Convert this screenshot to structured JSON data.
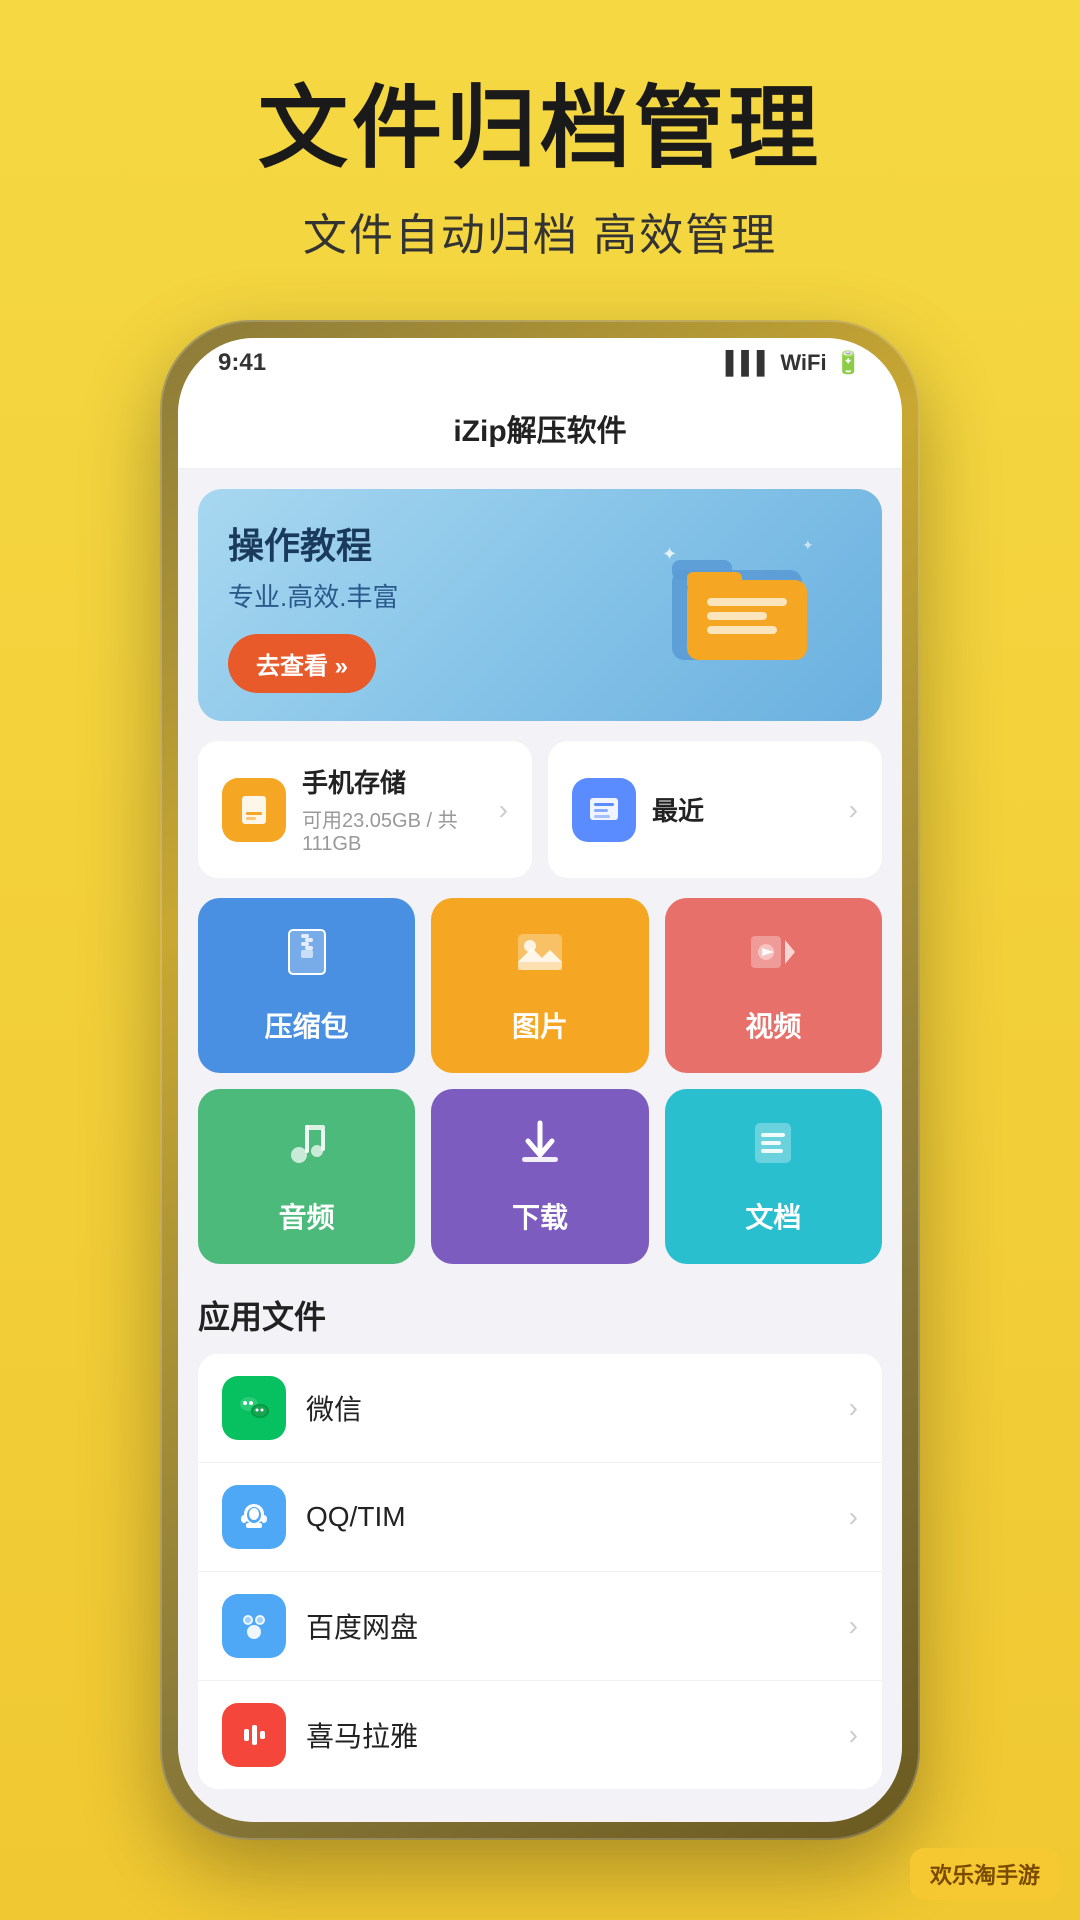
{
  "header": {
    "main_title": "文件归档管理",
    "sub_title": "文件自动归档 高效管理"
  },
  "app": {
    "title": "iZip解压软件"
  },
  "status_bar": {
    "time": "9:41",
    "icons": "●●●"
  },
  "tutorial": {
    "title": "操作教程",
    "subtitle": "专业.高效.丰富",
    "button_label": "去查看 »"
  },
  "storage": {
    "name": "手机存储",
    "detail": "可用23.05GB / 共111GB",
    "chevron": "›"
  },
  "recent": {
    "name": "最近",
    "chevron": "›"
  },
  "categories": [
    {
      "id": "zip",
      "label": "压缩包",
      "icon": "🗜",
      "color": "#4a90e2"
    },
    {
      "id": "image",
      "label": "图片",
      "icon": "🖼",
      "color": "#f5a623"
    },
    {
      "id": "video",
      "label": "视频",
      "icon": "▶",
      "color": "#e8706a"
    },
    {
      "id": "audio",
      "label": "音频",
      "icon": "♪",
      "color": "#4cba7a"
    },
    {
      "id": "download",
      "label": "下载",
      "icon": "⬇",
      "color": "#7c5cbf"
    },
    {
      "id": "docs",
      "label": "文档",
      "icon": "📄",
      "color": "#2abfcf"
    }
  ],
  "app_files": {
    "section_title": "应用文件",
    "items": [
      {
        "id": "wechat",
        "name": "微信",
        "icon": "💬",
        "bg": "#07c160"
      },
      {
        "id": "qq",
        "name": "QQ/TIM",
        "icon": "🐧",
        "bg": "#4fa8f5"
      },
      {
        "id": "baidu",
        "name": "百度网盘",
        "icon": "☁",
        "bg": "#4fa8f5"
      },
      {
        "id": "ximalaya",
        "name": "喜马拉雅",
        "icon": "🎵",
        "bg": "#f5463c"
      }
    ]
  },
  "watermark": {
    "text": "欢乐淘手游"
  },
  "chevron": "›"
}
